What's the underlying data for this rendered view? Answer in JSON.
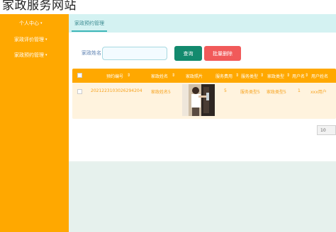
{
  "header": {
    "title": "家政服务网站"
  },
  "sidebar": {
    "items": [
      {
        "label": "个人中心"
      },
      {
        "label": "家政评价管理"
      },
      {
        "label": "家政预约管理"
      }
    ]
  },
  "tabs": [
    {
      "label": "家政预约管理"
    }
  ],
  "search": {
    "label": "家政姓名",
    "value": "",
    "placeholder": "",
    "search_button": "查询",
    "batch_delete_button": "批量删除"
  },
  "table": {
    "columns": [
      "预约编号",
      "家政姓名",
      "家政照片",
      "服务费用",
      "服务类型",
      "家政类型",
      "用户名",
      "用户姓名"
    ],
    "rows": [
      {
        "booking_no": "2021223103026294204",
        "housekeeper_name": "家政姓名5",
        "photo_icon": "housekeeper-photo",
        "fee": "5",
        "service_type": "服务类型5",
        "housekeeping_type": "家政类型5",
        "username": "1",
        "user_fullname": "xxx用户"
      }
    ]
  },
  "pagination": {
    "page_size": "10"
  },
  "colors": {
    "sidebar": "#ffa800",
    "table_header": "#ffa800",
    "tab_bar": "#d4f2f2",
    "search_button": "#138a6e",
    "delete_button": "#f15a5a"
  }
}
